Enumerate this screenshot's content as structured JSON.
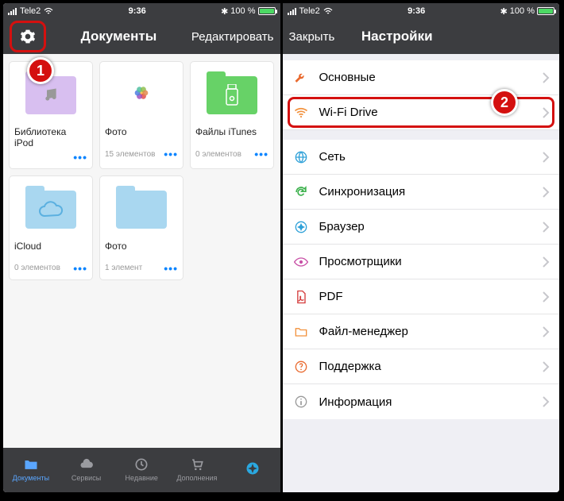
{
  "status": {
    "carrier": "Tele2",
    "time": "9:36",
    "battery": "100 %",
    "bluetooth": "✶"
  },
  "left": {
    "nav": {
      "title": "Документы",
      "edit": "Редактировать"
    },
    "tiles": [
      {
        "name": "Библиотека iPod",
        "sub": "",
        "color": "#d8bff0",
        "kind": "music"
      },
      {
        "name": "Фото",
        "sub": "15 элементов",
        "color": "#ffffff",
        "kind": "photos"
      },
      {
        "name": "Файлы iTunes",
        "sub": "0 элементов",
        "color": "#67d267",
        "kind": "usb"
      },
      {
        "name": "iCloud",
        "sub": "0 элементов",
        "color": "#a9d7f0",
        "kind": "cloud"
      },
      {
        "name": "Фото",
        "sub": "1 элемент",
        "color": "#a9d7f0",
        "kind": "plain"
      }
    ],
    "tabs": [
      {
        "label": "Документы",
        "icon": "folder",
        "active": true
      },
      {
        "label": "Сервисы",
        "icon": "cloud",
        "active": false
      },
      {
        "label": "Недавние",
        "icon": "clock",
        "active": false
      },
      {
        "label": "Дополнения",
        "icon": "cart",
        "active": false
      },
      {
        "label": "",
        "icon": "compass",
        "active": false,
        "accent": true
      }
    ]
  },
  "right": {
    "nav": {
      "close": "Закрыть",
      "title": "Настройки"
    },
    "rows": [
      {
        "label": "Основные",
        "icon": "wrench",
        "color": "#e96a2f"
      },
      {
        "label": "Wi-Fi Drive",
        "icon": "wifi",
        "color": "#f2913c",
        "highlight": true
      },
      {
        "label": "Сеть",
        "icon": "globe",
        "color": "#2da0d8"
      },
      {
        "label": "Синхронизация",
        "icon": "refresh",
        "color": "#3fb24f"
      },
      {
        "label": "Браузер",
        "icon": "compass",
        "color": "#2da0d8"
      },
      {
        "label": "Просмотрщики",
        "icon": "eye",
        "color": "#c84fa6"
      },
      {
        "label": "PDF",
        "icon": "pdf",
        "color": "#d43b3b"
      },
      {
        "label": "Файл-менеджер",
        "icon": "folder",
        "color": "#f2913c"
      },
      {
        "label": "Поддержка",
        "icon": "question",
        "color": "#e96a2f"
      },
      {
        "label": "Информация",
        "icon": "info",
        "color": "#999999"
      }
    ]
  },
  "markers": {
    "one": "1",
    "two": "2"
  }
}
